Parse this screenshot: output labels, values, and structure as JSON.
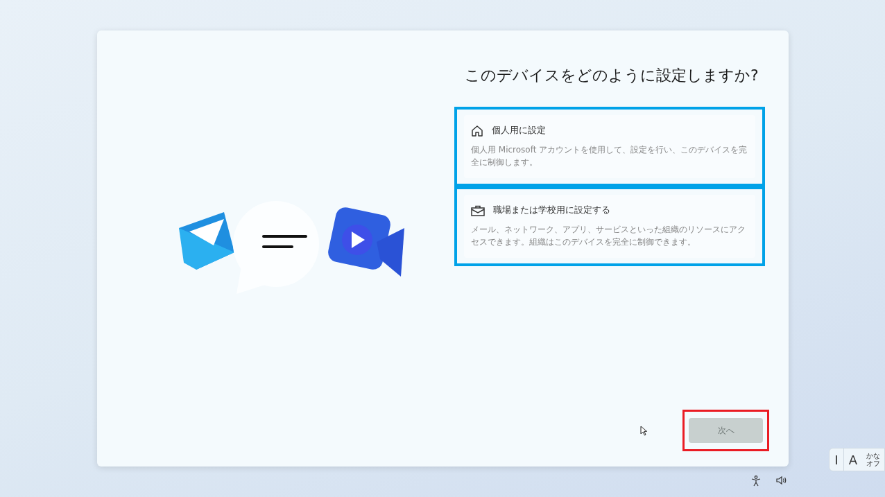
{
  "heading": "このデバイスをどのように設定しますか?",
  "options": [
    {
      "kind": "home",
      "title": "個人用に設定",
      "description": "個人用 Microsoft アカウントを使用して、設定を行い、このデバイスを完全に制御します。",
      "highlighted": true
    },
    {
      "kind": "work",
      "title": "職場または学校用に設定する",
      "description": "メール、ネットワーク、アプリ、サービスといった組織のリソースにアクセスできます。組織はこのデバイスを完全に制御できます。",
      "highlighted": true
    }
  ],
  "next_button": {
    "label": "次へ",
    "disabled": true,
    "highlighted": true
  },
  "ime": {
    "cursor": "I",
    "mode": "A",
    "kana_top": "かな",
    "kana_bottom": "オフ"
  }
}
